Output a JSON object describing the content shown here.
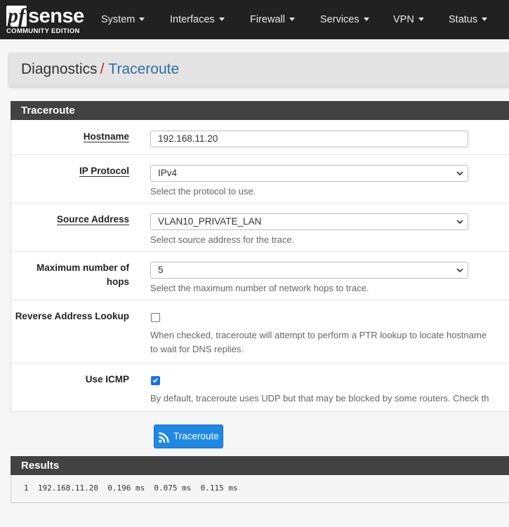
{
  "app": {
    "logo_main_pf": "pf",
    "logo_main_sense": "sense",
    "logo_sub": "COMMUNITY EDITION"
  },
  "nav": {
    "items": [
      {
        "label": "System"
      },
      {
        "label": "Interfaces"
      },
      {
        "label": "Firewall"
      },
      {
        "label": "Services"
      },
      {
        "label": "VPN"
      },
      {
        "label": "Status"
      }
    ]
  },
  "breadcrumb": {
    "parent": "Diagnostics",
    "separator": "/",
    "current": "Traceroute"
  },
  "traceroute_panel": {
    "title": "Traceroute",
    "hostname": {
      "label": "Hostname",
      "value": "192.168.11.20"
    },
    "ip_protocol": {
      "label": "IP Protocol",
      "value": "IPv4",
      "help": "Select the protocol to use."
    },
    "source_address": {
      "label": "Source Address",
      "value": "VLAN10_PRIVATE_LAN",
      "help": "Select source address for the trace."
    },
    "max_hops": {
      "label_line1": "Maximum number of",
      "label_line2": "hops",
      "value": "5",
      "help": "Select the maximum number of network hops to trace."
    },
    "reverse_lookup": {
      "label": "Reverse Address Lookup",
      "checked": false,
      "help_line1": "When checked, traceroute will attempt to perform a PTR lookup to locate hostname",
      "help_line2": "to wait for DNS replies."
    },
    "use_icmp": {
      "label": "Use ICMP",
      "checked": true,
      "help": "By default, traceroute uses UDP but that may be blocked by some routers. Check th"
    }
  },
  "actions": {
    "traceroute_button": "Traceroute"
  },
  "results_panel": {
    "title": "Results",
    "output": "1  192.168.11.20  0.196 ms  0.075 ms  0.115 ms"
  },
  "colors": {
    "navbar": "#212121",
    "panel_heading": "#424242",
    "accent": "#1e88e5",
    "breadcrumb_current": "#2f6ea6",
    "breadcrumb_separator": "#c62828"
  }
}
